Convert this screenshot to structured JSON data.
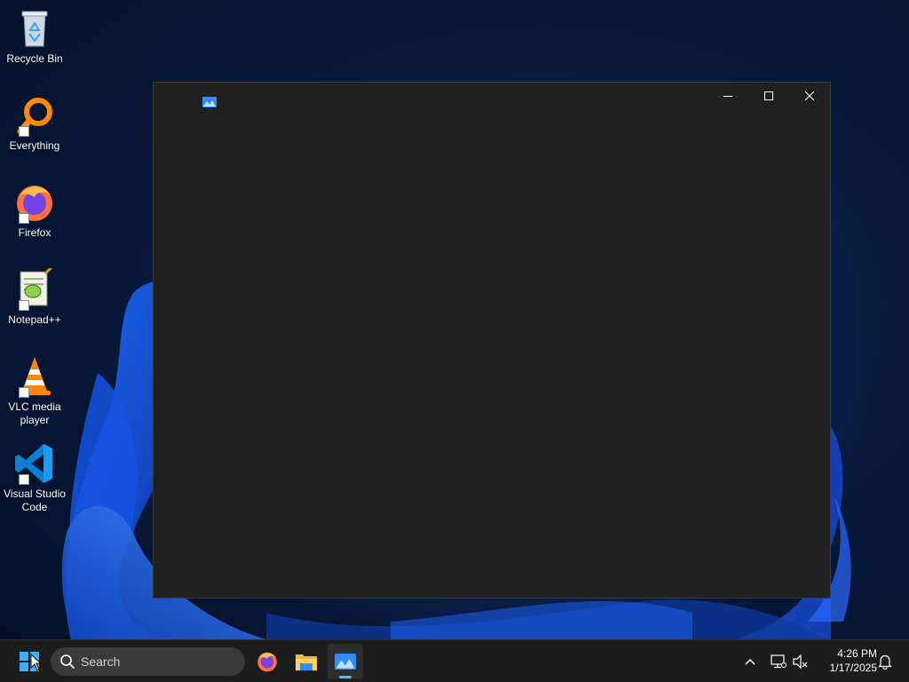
{
  "desktop": {
    "icons": [
      {
        "label": "Recycle Bin",
        "icon": "recycle-bin-icon",
        "shortcut": false
      },
      {
        "label": "Everything",
        "icon": "everything-search-icon",
        "shortcut": true
      },
      {
        "label": "Firefox",
        "icon": "firefox-icon",
        "shortcut": true
      },
      {
        "label": "Notepad++",
        "icon": "notepad-plus-plus-icon",
        "shortcut": true
      },
      {
        "label": "VLC media player",
        "icon": "vlc-cone-icon",
        "shortcut": true
      },
      {
        "label": "Visual Studio Code",
        "icon": "vscode-icon",
        "shortcut": true
      }
    ]
  },
  "window": {
    "title": "",
    "app_icon": "photos-app-icon",
    "controls": {
      "minimize": "minimize-icon",
      "maximize": "maximize-icon",
      "close": "close-icon"
    },
    "background": "#202020"
  },
  "taskbar": {
    "start_icon": "windows-logo-icon",
    "search": {
      "label": "Search",
      "icon": "search-icon"
    },
    "pinned": [
      {
        "name": "Firefox",
        "icon": "firefox-icon",
        "active": false
      },
      {
        "name": "File Explorer",
        "icon": "folder-icon",
        "active": false
      },
      {
        "name": "Photos",
        "icon": "photos-app-icon",
        "active": true
      }
    ],
    "tray": {
      "chevron_icon": "chevron-up-icon",
      "network_icon": "network-icon",
      "volume_icon": "volume-muted-icon",
      "time": "4:26 PM",
      "date": "1/17/2025",
      "notification_icon": "bell-icon"
    }
  },
  "colors": {
    "accent": "#4cc2ff",
    "taskbar": "#1c1c1c",
    "window_bg": "#202020"
  }
}
